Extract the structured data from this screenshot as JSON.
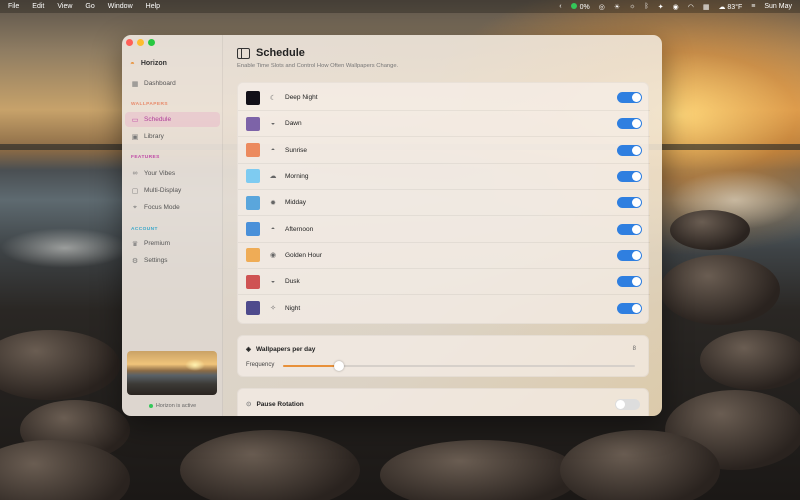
{
  "menubar": {
    "items": [
      "File",
      "Edit",
      "View",
      "Go",
      "Window",
      "Help"
    ],
    "battery": "0%",
    "weather": "83°F",
    "date": "Sun May"
  },
  "sidebar": {
    "app_name": "Horizon",
    "dashboard": "Dashboard",
    "section_wallpapers": "WALLPAPERS",
    "schedule": "Schedule",
    "library": "Library",
    "section_features": "FEATURES",
    "your_vibes": "Your Vibes",
    "multi_display": "Multi-Display",
    "focus_mode": "Focus Mode",
    "section_account": "ACCOUNT",
    "premium": "Premium",
    "settings": "Settings",
    "status": "Horizon is active",
    "colors": {
      "wallpapers": "#e88a6a",
      "features": "#c04aa6",
      "account": "#3aa8c9"
    }
  },
  "main": {
    "title": "Schedule",
    "subtitle": "Enable Time Slots and Control How Often Wallpapers Change."
  },
  "slots": [
    {
      "name": "Deep Night",
      "color": "#121018",
      "icon": "☾",
      "enabled": true
    },
    {
      "name": "Dawn",
      "color": "#7d63a8",
      "icon": "◒",
      "enabled": true
    },
    {
      "name": "Sunrise",
      "color": "#ec8a5e",
      "icon": "◓",
      "enabled": true
    },
    {
      "name": "Morning",
      "color": "#7ecbf1",
      "icon": "☁",
      "enabled": true
    },
    {
      "name": "Midday",
      "color": "#5aa6dc",
      "icon": "✹",
      "enabled": true
    },
    {
      "name": "Afternoon",
      "color": "#4a90d9",
      "icon": "◓",
      "enabled": true
    },
    {
      "name": "Golden Hour",
      "color": "#efac56",
      "icon": "◉",
      "enabled": true
    },
    {
      "name": "Dusk",
      "color": "#cf5353",
      "icon": "◒",
      "enabled": true
    },
    {
      "name": "Night",
      "color": "#4e4a8c",
      "icon": "✧",
      "enabled": true
    }
  ],
  "wallpapers_per_day": {
    "label": "Wallpapers per day",
    "value": "8",
    "frequency_label": "Frequency",
    "fraction": 0.16,
    "accent": "#e8913a"
  },
  "pause": {
    "label": "Pause Rotation",
    "enabled": false
  }
}
